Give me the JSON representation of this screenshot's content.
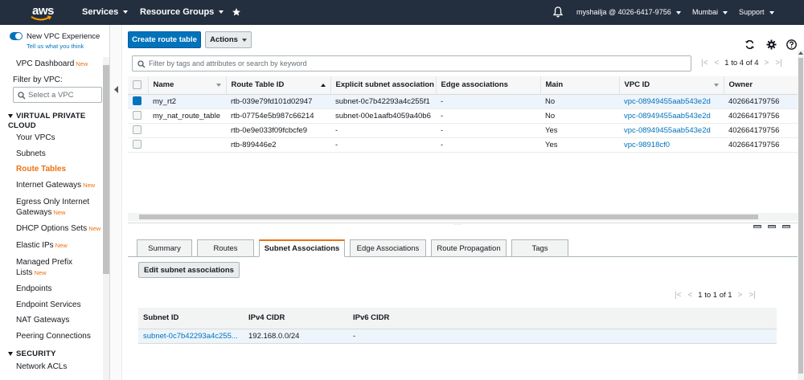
{
  "topnav": {
    "logo": "aws",
    "services": "Services",
    "resource_groups": "Resource Groups",
    "account": "myshailja @ 4026-6417-9756",
    "region": "Mumbai",
    "support": "Support",
    "bg_color": "#232f3e",
    "icons": [
      "pin-icon",
      "bell-icon"
    ]
  },
  "sidebar": {
    "new_experience_label": "New VPC Experience",
    "tell_us": "Tell us what you think",
    "vpc_dashboard": "VPC Dashboard",
    "new_badge": "New",
    "filter_label": "Filter by VPC:",
    "select_placeholder": "Select a VPC",
    "section_vpc": "VIRTUAL PRIVATE CLOUD",
    "items": [
      {
        "label": "Your VPCs",
        "new": ""
      },
      {
        "label": "Subnets",
        "new": ""
      },
      {
        "label": "Route Tables",
        "new": "",
        "active": true
      },
      {
        "label": "Internet Gateways",
        "new": "New"
      },
      {
        "label": "Egress Only Internet",
        "label2": "Gateways",
        "new": "New"
      },
      {
        "label": "DHCP Options Sets",
        "new": "New"
      },
      {
        "label": "Elastic IPs",
        "new": "New"
      },
      {
        "label": "Managed Prefix",
        "label2": "Lists",
        "new": "New"
      },
      {
        "label": "Endpoints",
        "new": ""
      },
      {
        "label": "Endpoint Services",
        "new": ""
      },
      {
        "label": "NAT Gateways",
        "new": ""
      },
      {
        "label": "Peering Connections",
        "new": ""
      }
    ],
    "section_security": "SECURITY",
    "security_items": [
      {
        "label": "Network ACLs"
      }
    ],
    "accent_color": "#ec7211"
  },
  "toolbar": {
    "create_label": "Create route table",
    "actions_label": "Actions"
  },
  "filter": {
    "placeholder": "Filter by tags and attributes or search by keyword",
    "pager_text": "1 to 4 of 4"
  },
  "route_table": {
    "columns": [
      "Name",
      "Route Table ID",
      "Explicit subnet association",
      "Edge associations",
      "Main",
      "VPC ID",
      "Owner"
    ],
    "rows": [
      {
        "name": "my_rt2",
        "id": "rtb-039e79fd101d02947",
        "explicit": "subnet-0c7b42293a4c255f1",
        "edge": "-",
        "main": "No",
        "vpc": "vpc-08949455aab543e2d",
        "owner": "402664179756",
        "selected": true
      },
      {
        "name": "my_nat_route_table",
        "id": "rtb-07754e5b987c66214",
        "explicit": "subnet-00e1aafb4059a40b6",
        "edge": "-",
        "main": "No",
        "vpc": "vpc-08949455aab543e2d",
        "owner": "402664179756",
        "selected": false
      },
      {
        "name": "",
        "id": "rtb-0e9e033f09fcbcfe9",
        "explicit": "-",
        "edge": "-",
        "main": "Yes",
        "vpc": "vpc-08949455aab543e2d",
        "owner": "402664179756",
        "selected": false
      },
      {
        "name": "",
        "id": "rtb-899446e2",
        "explicit": "-",
        "edge": "-",
        "main": "Yes",
        "vpc": "vpc-98918cf0",
        "owner": "402664179756",
        "selected": false
      }
    ]
  },
  "detail": {
    "tabs": [
      "Summary",
      "Routes",
      "Subnet Associations",
      "Edge Associations",
      "Route Propagation",
      "Tags"
    ],
    "active_tab": "Subnet Associations",
    "edit_label": "Edit subnet associations",
    "pager_text": "1 to 1 of 1",
    "columns": [
      "Subnet ID",
      "IPv4 CIDR",
      "IPv6 CIDR"
    ],
    "rows": [
      {
        "subnet": "subnet-0c7b42293a4c255...",
        "ipv4": "192.168.0.0/24",
        "ipv6": "-"
      }
    ]
  }
}
